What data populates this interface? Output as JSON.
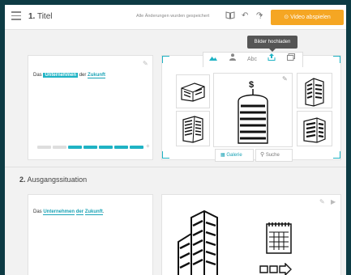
{
  "header": {
    "title_number": "1.",
    "title": "Titel",
    "saved_status": "Alle Änderungen wurden gespeichert",
    "help_label": "?",
    "play_label": "Video abspielen"
  },
  "tooltip": "Bilder hochladen",
  "scene1": {
    "text_prefix": "Das",
    "word_highlight": "Unternehmen",
    "text_mid": "der",
    "word_link": "Zukunft",
    "progress_filled": 6,
    "progress_total": 8
  },
  "picker": {
    "tabs": [
      "landscape-icon",
      "person-icon",
      "text-icon",
      "upload-icon",
      "image-icon"
    ],
    "text_tab_label": "Abc",
    "gallery_label": "Galerie",
    "search_label": "Suche"
  },
  "scene2": {
    "section_number": "2.",
    "section_title": "Ausgangssituation",
    "text_prefix": "Das",
    "word1": "Unternehmen",
    "word2": "der",
    "word3": "Zukunft",
    "suffix": "."
  },
  "colors": {
    "accent": "#1fb3c4",
    "play": "#f5a623",
    "frame": "#0d3b44"
  }
}
